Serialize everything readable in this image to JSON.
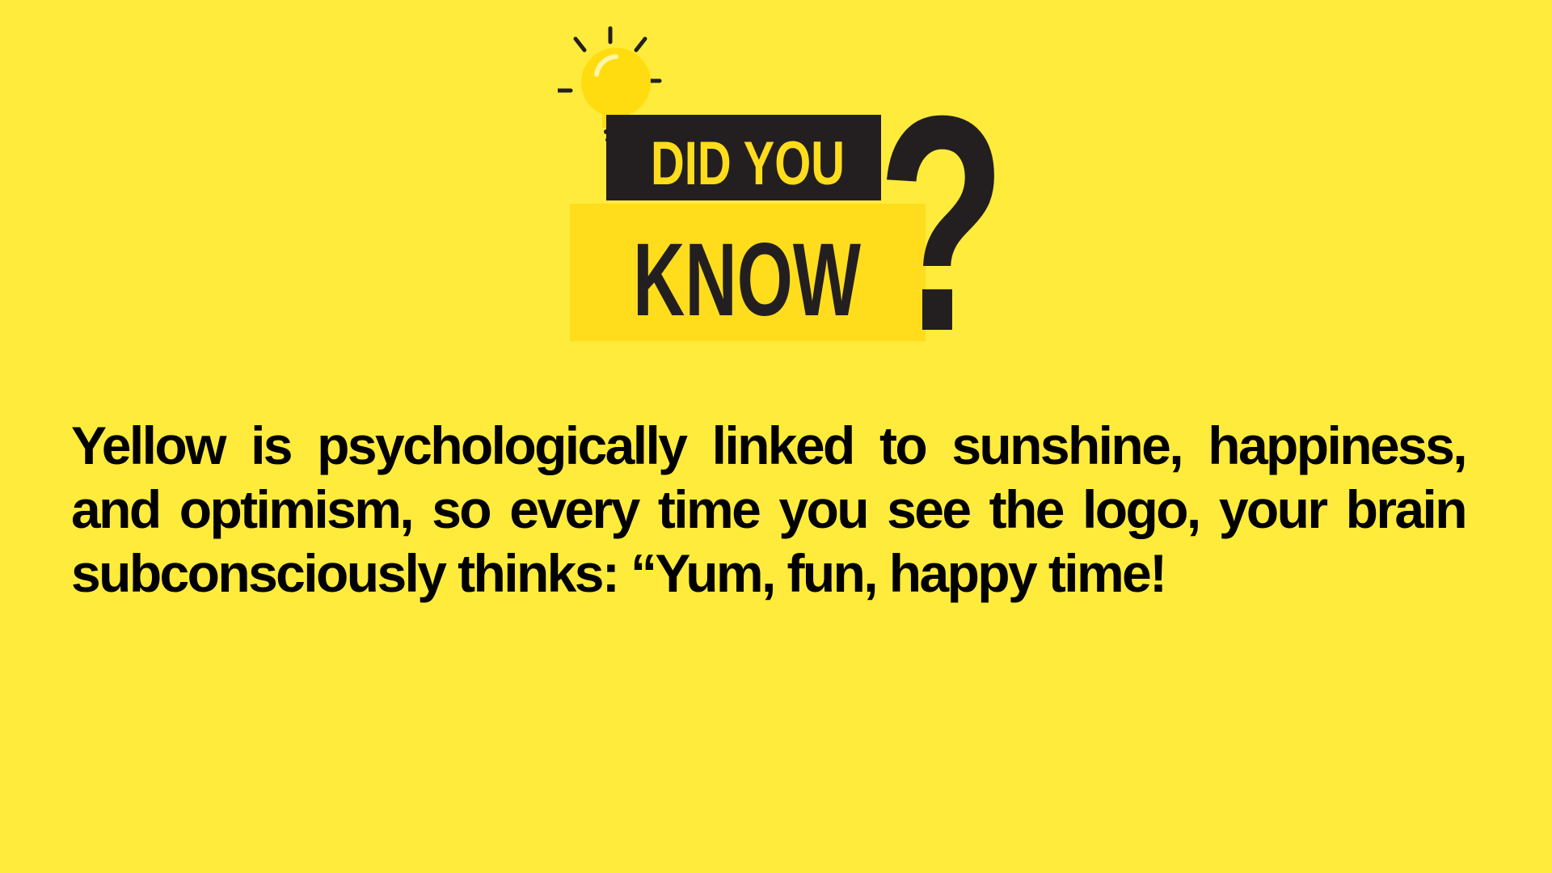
{
  "logo": {
    "line1": "DID YOU",
    "line2": "KNOW",
    "symbol": "?",
    "icon": "lightbulb-icon"
  },
  "fact": {
    "text": "Yellow is psychologically linked to sunshine, happiness, and optimism, so every time you see the logo, your brain subconsciously thinks: “Yum, fun, happy time!"
  },
  "colors": {
    "background": "#FFEB3B",
    "logo_dark": "#231F20",
    "logo_yellow": "#FFDD1C",
    "bulb": "#FFDC0F",
    "text": "#000000"
  }
}
